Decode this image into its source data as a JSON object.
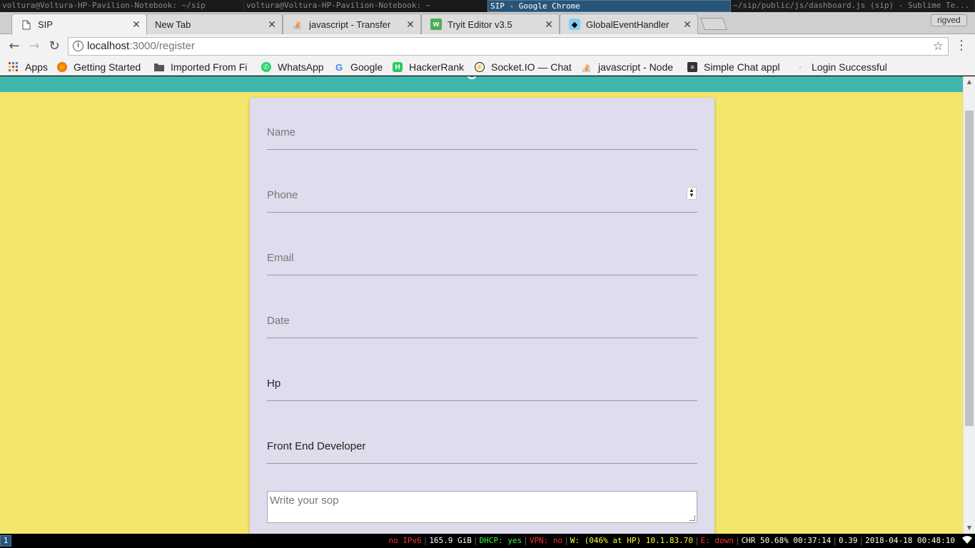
{
  "wm": {
    "titles": [
      "voltura@Voltura-HP-Pavilion-Notebook: ~/sip",
      "voltura@Voltura-HP-Pavilion-Notebook: ~",
      "SIP - Google Chrome",
      "~/sip/public/js/dashboard.js (sip) - Sublime Te..."
    ]
  },
  "tabs": [
    {
      "label": "SIP",
      "icon": "page-icon"
    },
    {
      "label": "New Tab",
      "icon": ""
    },
    {
      "label": "javascript - Transfer",
      "icon": "stackoverflow-icon"
    },
    {
      "label": "Tryit Editor v3.5",
      "icon": "w3schools-icon"
    },
    {
      "label": "GlobalEventHandler",
      "icon": "mdn-icon"
    }
  ],
  "profile_name": "rigved",
  "omnibox": {
    "host": "localhost",
    "path": ":3000/register"
  },
  "bookmarks": [
    {
      "label": "Apps",
      "icon": "apps-grid-icon"
    },
    {
      "label": "Getting Started",
      "icon": "firefox-icon"
    },
    {
      "label": "Imported From Fi",
      "icon": "folder-icon"
    },
    {
      "label": "WhatsApp",
      "icon": "whatsapp-icon"
    },
    {
      "label": "Google",
      "icon": "google-icon"
    },
    {
      "label": "HackerRank",
      "icon": "hackerrank-icon"
    },
    {
      "label": "Socket.IO — Chat",
      "icon": "socketio-icon"
    },
    {
      "label": "javascript - Node",
      "icon": "stackoverflow-icon"
    },
    {
      "label": "Simple Chat appl",
      "icon": "doc-icon"
    },
    {
      "label": "Login Successful",
      "icon": "page-icon"
    }
  ],
  "form": {
    "name_placeholder": "Name",
    "phone_placeholder": "Phone",
    "email_placeholder": "Email",
    "date_placeholder": "Date",
    "company_value": "Hp",
    "role_value": "Front End Developer",
    "sop_placeholder": "Write your sop"
  },
  "status": {
    "workspace": "1",
    "ipv6": "no IPv6",
    "disk": "165.9 GiB",
    "dhcp": "DHCP: yes",
    "vpn": "VPN: no",
    "wifi": "W: (046% at HP) 10.1.83.70",
    "eth": "E: down",
    "battery": "CHR 50.68% 00:37:14",
    "load": "0.39",
    "datetime": "2018-04-18 00:48:10"
  },
  "colors": {
    "page_bg": "#f2e66c",
    "header_teal": "#3eb8ad",
    "card_bg": "#dfdced",
    "wm_active": "#285577"
  }
}
